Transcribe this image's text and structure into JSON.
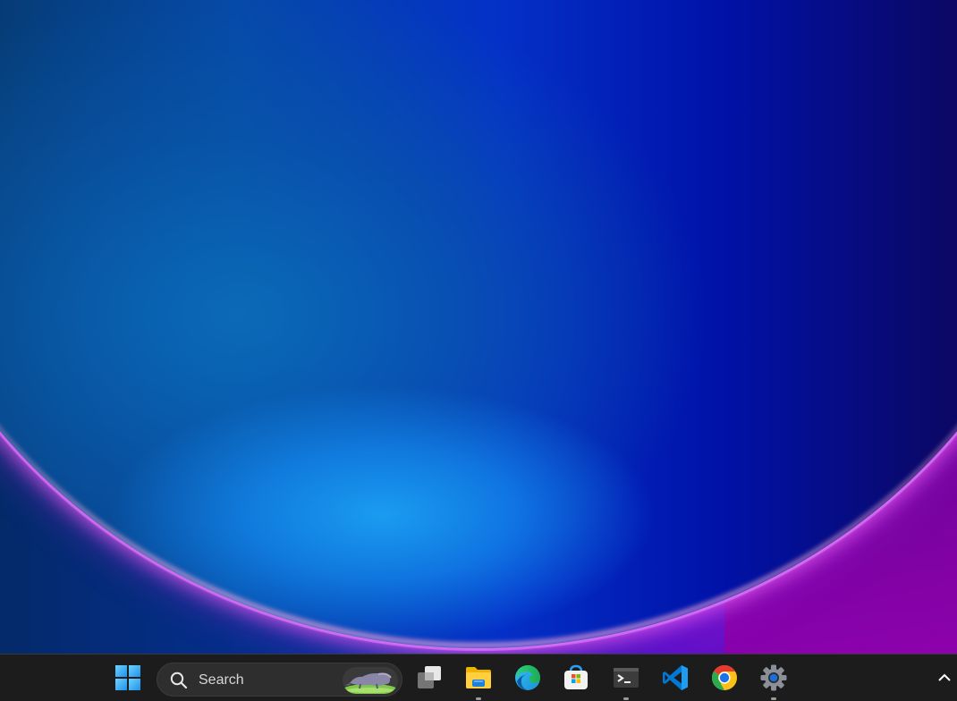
{
  "desktop": {
    "wallpaper": "windows-11-bloom-wallpaper",
    "colors": {
      "accent_blue": "#0433a8",
      "glow_pink": "#e05af0",
      "glow_purple": "#9a0cc0",
      "light_blue": "#1a9cf0"
    }
  },
  "taskbar": {
    "background": "#1c1c1c",
    "start": {
      "icon": "windows-logo-icon"
    },
    "search": {
      "label": "Search",
      "icon": "search-icon",
      "highlight": "anteater-search-highlight-image"
    },
    "apps": [
      {
        "name": "Task View",
        "icon": "task-view-icon",
        "running": false
      },
      {
        "name": "File Explorer",
        "icon": "file-explorer-icon",
        "running": true
      },
      {
        "name": "Microsoft Edge",
        "icon": "edge-icon",
        "running": false
      },
      {
        "name": "Microsoft Store",
        "icon": "store-icon",
        "running": false
      },
      {
        "name": "Terminal",
        "icon": "terminal-icon",
        "running": true
      },
      {
        "name": "Visual Studio Code",
        "icon": "vscode-icon",
        "running": false
      },
      {
        "name": "Google Chrome",
        "icon": "chrome-icon",
        "running": false
      },
      {
        "name": "Settings",
        "icon": "settings-icon",
        "running": true
      }
    ],
    "tray": {
      "show_hidden_icon": "chevron-up-icon"
    }
  }
}
